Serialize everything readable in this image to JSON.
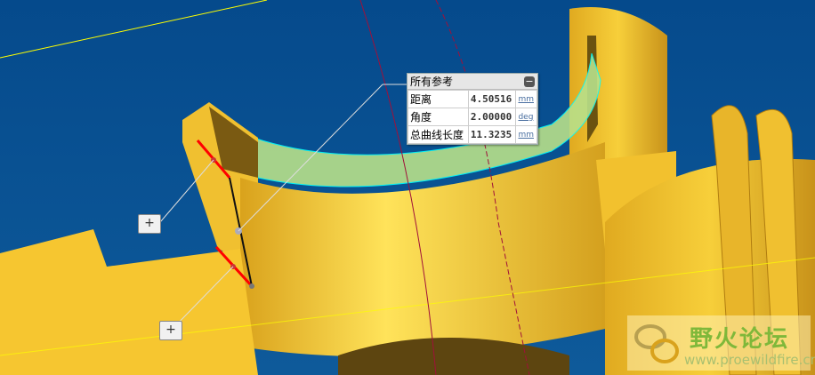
{
  "measure_panel": {
    "title": "所有参考",
    "collapse_icon": "minus-icon",
    "rows": [
      {
        "label": "距离",
        "value": "4.50516",
        "unit": "mm"
      },
      {
        "label": "角度",
        "value": "2.00000",
        "unit": "deg"
      },
      {
        "label": "总曲线长度",
        "value": "11.3235",
        "unit": "mm"
      }
    ]
  },
  "ref_buttons": [
    {
      "icon": "plus-icon",
      "label": "+"
    },
    {
      "icon": "plus-icon",
      "label": "+"
    }
  ],
  "watermark": {
    "title": "野火论坛",
    "url": "www.proewildfire.cn"
  },
  "colors": {
    "background": "#0d4f8f",
    "part": "#f2c12e",
    "highlight": "#b8e08a",
    "measure": "#ff0000"
  }
}
